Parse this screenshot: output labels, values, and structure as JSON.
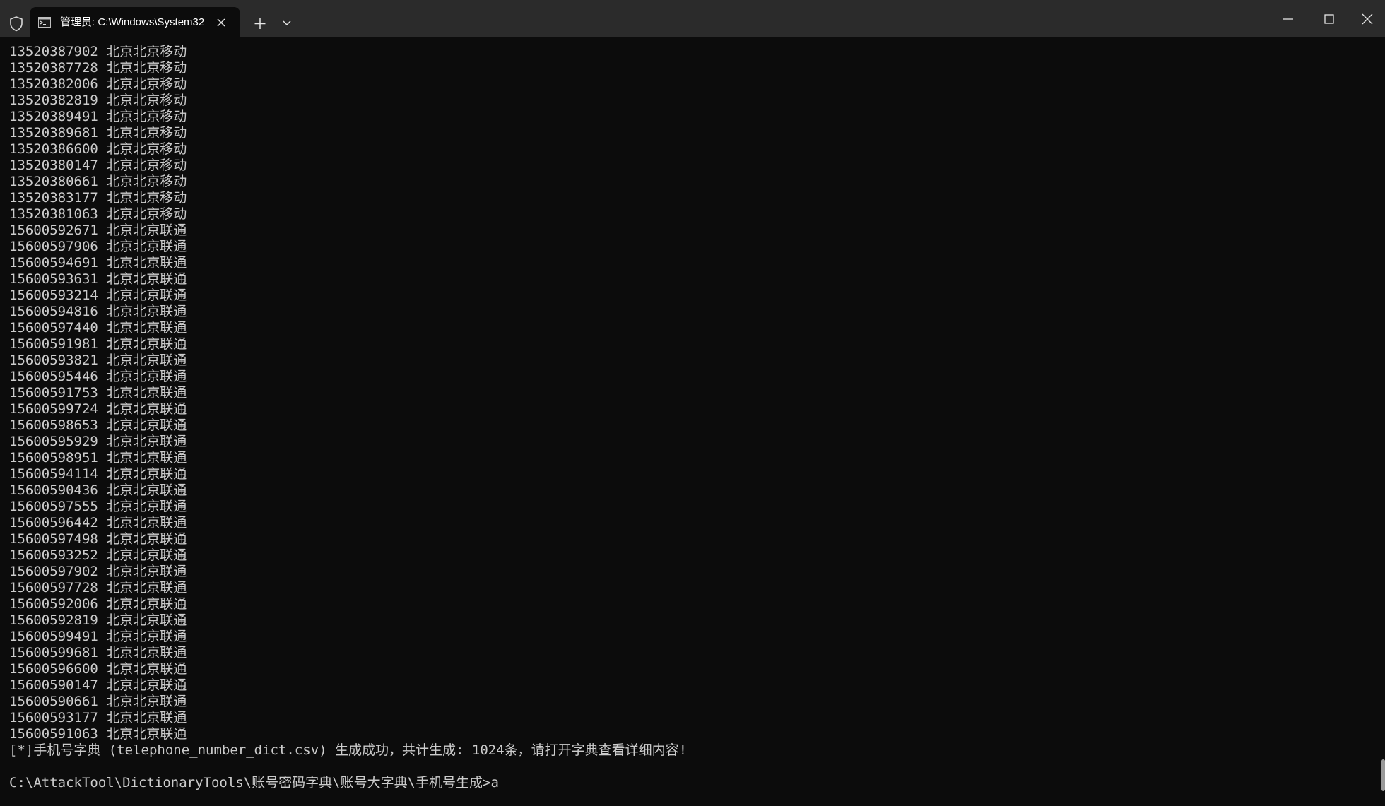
{
  "window": {
    "tab_title": "管理员: C:\\Windows\\System32"
  },
  "icons": {
    "shield": "shield-icon",
    "tab": "terminal-icon",
    "tab_close": "close-icon",
    "new_tab": "plus-icon",
    "dropdown": "chevron-down-icon",
    "minimize": "minimize-icon",
    "maximize": "maximize-icon",
    "close": "close-icon"
  },
  "colors": {
    "titlebar": "#2b2b2b",
    "terminal_bg": "#0c0c0c",
    "terminal_text": "#cccccc"
  },
  "terminal": {
    "rows": [
      {
        "number": "13520387902",
        "location": "北京北京移动"
      },
      {
        "number": "13520387728",
        "location": "北京北京移动"
      },
      {
        "number": "13520382006",
        "location": "北京北京移动"
      },
      {
        "number": "13520382819",
        "location": "北京北京移动"
      },
      {
        "number": "13520389491",
        "location": "北京北京移动"
      },
      {
        "number": "13520389681",
        "location": "北京北京移动"
      },
      {
        "number": "13520386600",
        "location": "北京北京移动"
      },
      {
        "number": "13520380147",
        "location": "北京北京移动"
      },
      {
        "number": "13520380661",
        "location": "北京北京移动"
      },
      {
        "number": "13520383177",
        "location": "北京北京移动"
      },
      {
        "number": "13520381063",
        "location": "北京北京移动"
      },
      {
        "number": "15600592671",
        "location": "北京北京联通"
      },
      {
        "number": "15600597906",
        "location": "北京北京联通"
      },
      {
        "number": "15600594691",
        "location": "北京北京联通"
      },
      {
        "number": "15600593631",
        "location": "北京北京联通"
      },
      {
        "number": "15600593214",
        "location": "北京北京联通"
      },
      {
        "number": "15600594816",
        "location": "北京北京联通"
      },
      {
        "number": "15600597440",
        "location": "北京北京联通"
      },
      {
        "number": "15600591981",
        "location": "北京北京联通"
      },
      {
        "number": "15600593821",
        "location": "北京北京联通"
      },
      {
        "number": "15600595446",
        "location": "北京北京联通"
      },
      {
        "number": "15600591753",
        "location": "北京北京联通"
      },
      {
        "number": "15600599724",
        "location": "北京北京联通"
      },
      {
        "number": "15600598653",
        "location": "北京北京联通"
      },
      {
        "number": "15600595929",
        "location": "北京北京联通"
      },
      {
        "number": "15600598951",
        "location": "北京北京联通"
      },
      {
        "number": "15600594114",
        "location": "北京北京联通"
      },
      {
        "number": "15600590436",
        "location": "北京北京联通"
      },
      {
        "number": "15600597555",
        "location": "北京北京联通"
      },
      {
        "number": "15600596442",
        "location": "北京北京联通"
      },
      {
        "number": "15600597498",
        "location": "北京北京联通"
      },
      {
        "number": "15600593252",
        "location": "北京北京联通"
      },
      {
        "number": "15600597902",
        "location": "北京北京联通"
      },
      {
        "number": "15600597728",
        "location": "北京北京联通"
      },
      {
        "number": "15600592006",
        "location": "北京北京联通"
      },
      {
        "number": "15600592819",
        "location": "北京北京联通"
      },
      {
        "number": "15600599491",
        "location": "北京北京联通"
      },
      {
        "number": "15600599681",
        "location": "北京北京联通"
      },
      {
        "number": "15600596600",
        "location": "北京北京联通"
      },
      {
        "number": "15600590147",
        "location": "北京北京联通"
      },
      {
        "number": "15600590661",
        "location": "北京北京联通"
      },
      {
        "number": "15600593177",
        "location": "北京北京联通"
      },
      {
        "number": "15600591063",
        "location": "北京北京联通"
      }
    ],
    "status_message": "[*]手机号字典 (telephone_number_dict.csv) 生成成功，共计生成: 1024条，请打开字典查看详细内容!",
    "prompt": "C:\\AttackTool\\DictionaryTools\\账号密码字典\\账号大字典\\手机号生成>a"
  }
}
